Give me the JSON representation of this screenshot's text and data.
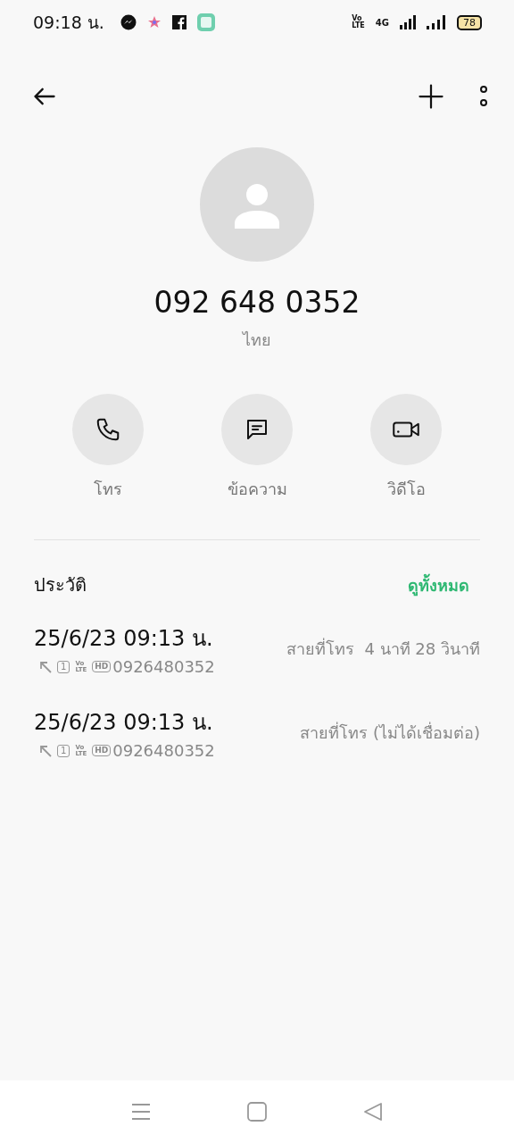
{
  "status_bar": {
    "time": "09:18 น.",
    "volte": [
      "Vo",
      "LTE"
    ],
    "network": "4G",
    "battery": "78"
  },
  "contact": {
    "number": "092 648 0352",
    "location": "ไทย"
  },
  "actions": [
    {
      "kind": "call",
      "label": "โทร"
    },
    {
      "kind": "message",
      "label": "ข้อความ"
    },
    {
      "kind": "video",
      "label": "วิดีโอ"
    }
  ],
  "history": {
    "title": "ประวัติ",
    "view_all": "ดูทั้งหมด",
    "entries": [
      {
        "datetime": "25/6/23 09:13 น.",
        "sim": "1",
        "volte": [
          "Vo",
          "LTE"
        ],
        "quality": "HD",
        "number": "0926480352",
        "detail": "สายที่โทร  4 นาที 28 วินาที"
      },
      {
        "datetime": "25/6/23 09:13 น.",
        "sim": "1",
        "volte": [
          "Vo",
          "LTE"
        ],
        "quality": "HD",
        "number": "0926480352",
        "detail": "สายที่โทร (ไม่ได้เชื่อมต่อ)"
      }
    ]
  }
}
